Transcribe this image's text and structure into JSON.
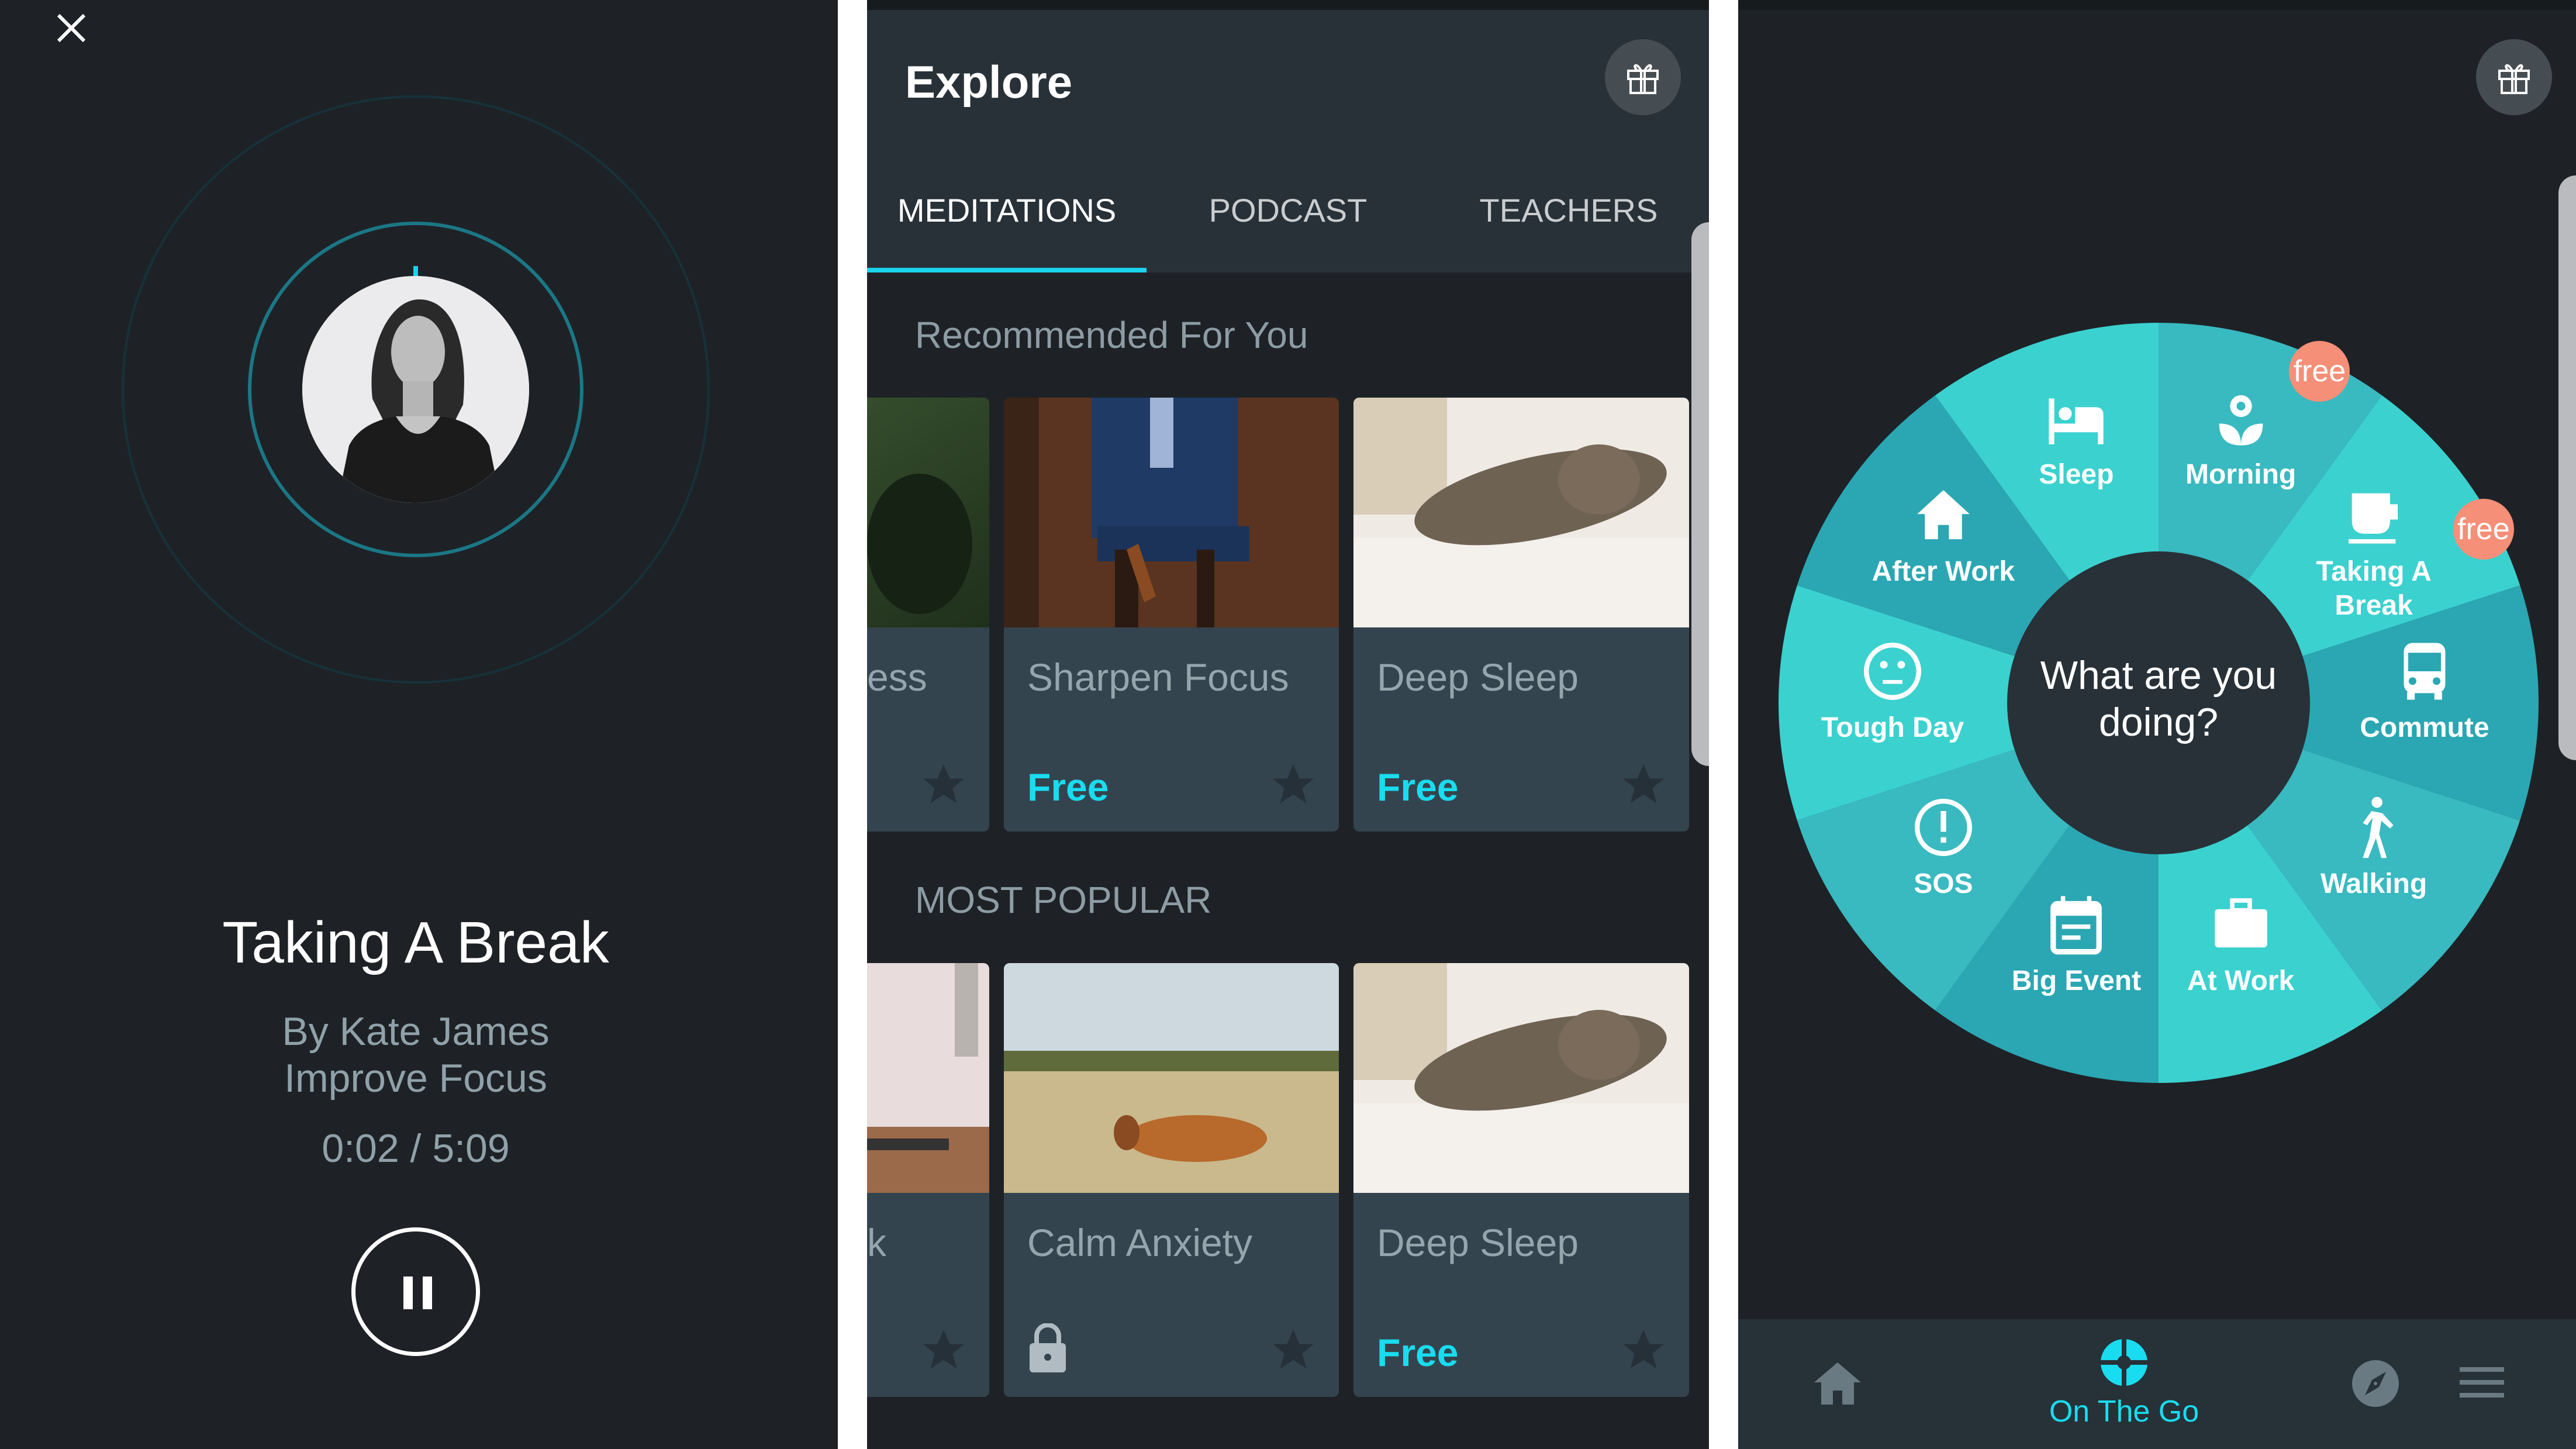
{
  "player": {
    "close_icon": "close-icon",
    "title": "Taking A Break",
    "author": "By Kate James",
    "category": "Improve Focus",
    "time": "0:02 / 5:09",
    "progress_fraction": 0.006,
    "pause_icon": "pause-icon",
    "teacher_avatar": "teacher-photo"
  },
  "explore": {
    "title": "Explore",
    "gift_icon": "gift-icon",
    "tabs": [
      {
        "label": "MEDITATIONS",
        "active": true
      },
      {
        "label": "PODCAST",
        "active": false
      },
      {
        "label": "TEACHERS",
        "active": false
      }
    ],
    "sections": [
      {
        "title": "Recommended For You",
        "cards": [
          {
            "name": "ess",
            "badge": "",
            "image": "green-grass",
            "star": true
          },
          {
            "name": "Sharpen Focus",
            "badge": "Free",
            "image": "man-in-suit",
            "star": true
          },
          {
            "name": "Deep Sleep",
            "badge": "Free",
            "image": "sleeping-cat",
            "star": true
          }
        ]
      },
      {
        "title": "MOST POPULAR",
        "cards": [
          {
            "name": "k",
            "badge": "",
            "image": "kitchen-table",
            "star": true
          },
          {
            "name": "Calm Anxiety",
            "badge": "locked",
            "image": "deer-in-field",
            "star": true
          },
          {
            "name": "Deep Sleep",
            "badge": "Free",
            "image": "sleeping-cat",
            "star": true
          }
        ]
      }
    ]
  },
  "on_the_go": {
    "gift_icon": "gift-icon",
    "center_question": "What are you doing?",
    "free_badge_label": "free",
    "segments": [
      {
        "label": "Morning",
        "icon": "flower-icon",
        "free": true
      },
      {
        "label": "Taking A Break",
        "icon": "coffee-cup-icon",
        "free": true
      },
      {
        "label": "Commute",
        "icon": "bus-icon",
        "free": false
      },
      {
        "label": "Walking",
        "icon": "walking-icon",
        "free": false
      },
      {
        "label": "At Work",
        "icon": "briefcase-icon",
        "free": false
      },
      {
        "label": "Big Event",
        "icon": "calendar-icon",
        "free": false
      },
      {
        "label": "SOS",
        "icon": "alert-icon",
        "free": false
      },
      {
        "label": "Tough Day",
        "icon": "neutral-face-icon",
        "free": false
      },
      {
        "label": "After Work",
        "icon": "home-icon",
        "free": false
      },
      {
        "label": "Sleep",
        "icon": "bed-icon",
        "free": false
      }
    ],
    "colors": {
      "light": "#3bd1cf",
      "mid": "#39b9c0",
      "dark": "#2aa7b3",
      "center": "#283138",
      "badge": "#f58f78"
    },
    "bottom_nav": [
      {
        "label": "",
        "icon": "home-icon",
        "active": false
      },
      {
        "label": "On The Go",
        "icon": "on-the-go-icon",
        "active": true
      },
      {
        "label": "",
        "icon": "compass-icon",
        "active": false
      },
      {
        "label": "",
        "icon": "menu-icon",
        "active": false
      }
    ]
  },
  "colors": {
    "accent": "#19dcf0",
    "background": "#1e2226",
    "card": "#34444e"
  }
}
